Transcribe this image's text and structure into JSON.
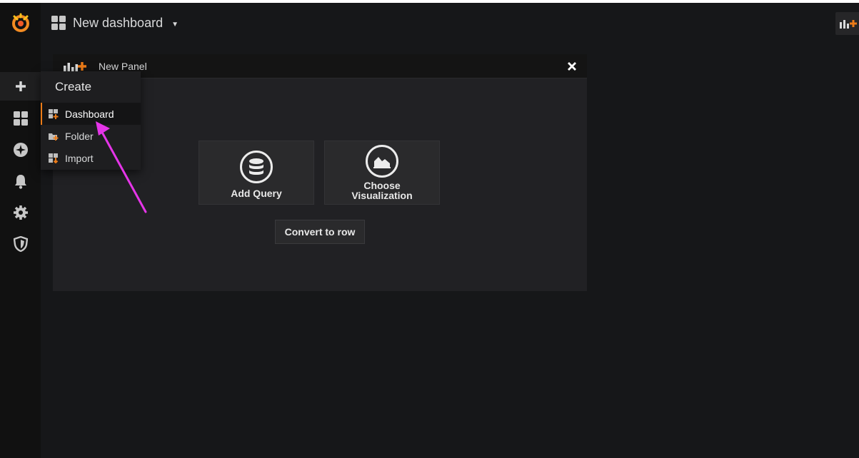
{
  "topbar": {
    "dashboard_title": "New dashboard"
  },
  "sidebar": {
    "items": [
      {
        "icon": "grafana-logo-icon"
      },
      {
        "icon": "plus-icon"
      },
      {
        "icon": "dashboards-grid-icon"
      },
      {
        "icon": "explore-compass-icon"
      },
      {
        "icon": "bell-icon"
      },
      {
        "icon": "gear-icon"
      },
      {
        "icon": "shield-icon"
      }
    ]
  },
  "create_menu": {
    "header": "Create",
    "items": [
      {
        "label": "Dashboard",
        "icon": "dashboard-plus-icon",
        "active": true
      },
      {
        "label": "Folder",
        "icon": "folder-plus-icon"
      },
      {
        "label": "Import",
        "icon": "import-icon"
      }
    ]
  },
  "panel": {
    "title": "New Panel",
    "add_query_label": "Add Query",
    "choose_viz_line1": "Choose",
    "choose_viz_line2": "Visualization",
    "convert_label": "Convert to row"
  },
  "colors": {
    "accent": "#eb7b18",
    "annotation_arrow": "#e535e8",
    "background": "#161719"
  }
}
